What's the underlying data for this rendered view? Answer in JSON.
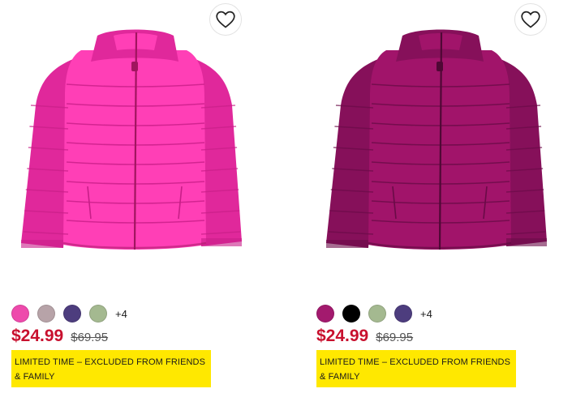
{
  "products": [
    {
      "colors": {
        "main": "#ff3fb6",
        "shade": "#e0289b",
        "line": "#c81e88",
        "zip": "#a0155f"
      },
      "swatches": [
        "#ee4aac",
        "#b7a3a8",
        "#4d3d7e",
        "#a4b990"
      ],
      "more_colors": "+4",
      "sale_price": "$24.99",
      "original_price": "$69.95",
      "promo": "LIMITED TIME – EXCLUDED FROM FRIENDS & FAMILY",
      "favorite_icon": "heart-outline"
    },
    {
      "colors": {
        "main": "#a1146a",
        "shade": "#86105a",
        "line": "#6a0b47",
        "zip": "#4f0835"
      },
      "swatches": [
        "#a31a6e",
        "#000000",
        "#a4b990",
        "#4d3d7e"
      ],
      "more_colors": "+4",
      "sale_price": "$24.99",
      "original_price": "$69.95",
      "promo": "LIMITED TIME – EXCLUDED FROM FRIENDS & FAMILY",
      "favorite_icon": "heart-outline"
    }
  ]
}
